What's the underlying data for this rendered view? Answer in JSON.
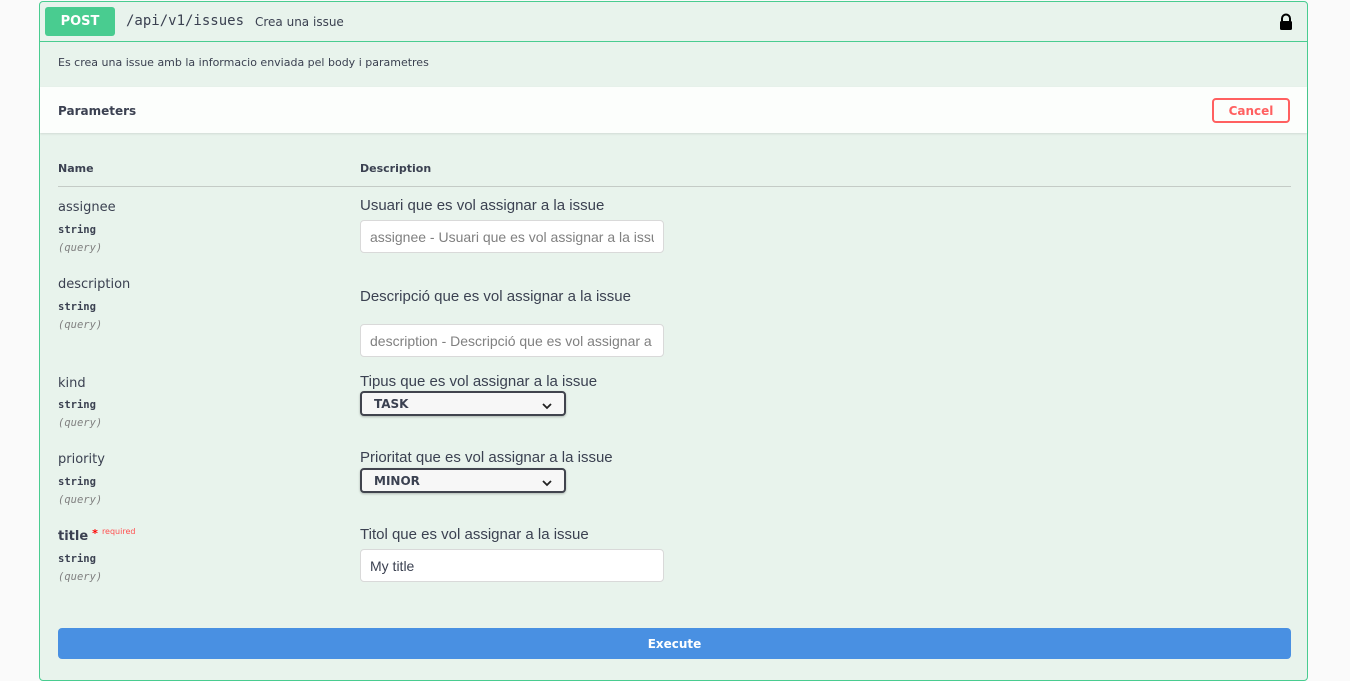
{
  "operation": {
    "method": "POST",
    "path": "/api/v1/issues",
    "summary": "Crea una issue",
    "description": "Es crea una issue amb la informacio enviada pel body i parametres"
  },
  "parameters_section": {
    "title": "Parameters",
    "cancel_label": "Cancel",
    "col_name": "Name",
    "col_description": "Description"
  },
  "params": [
    {
      "name": "assignee",
      "type": "string",
      "in": "(query)",
      "description": "Usuari que es vol assignar a la issue",
      "placeholder": "assignee - Usuari que es vol assignar a la issue",
      "value": ""
    },
    {
      "name": "description",
      "type": "string",
      "in": "(query)",
      "description": "Descripció que es vol assignar a la issue",
      "placeholder": "description - Descripció que es vol assignar a la issue",
      "value": ""
    },
    {
      "name": "kind",
      "type": "string",
      "in": "(query)",
      "description": "Tipus que es vol assignar a la issue",
      "selected": "TASK"
    },
    {
      "name": "priority",
      "type": "string",
      "in": "(query)",
      "description": "Prioritat que es vol assignar a la issue",
      "selected": "MINOR"
    },
    {
      "name": "title",
      "type": "string",
      "in": "(query)",
      "description": "Titol que es vol assignar a la issue",
      "required_mark": "*",
      "required_label": "required",
      "value": "My title"
    }
  ],
  "execute_label": "Execute",
  "colors": {
    "post": "#49cc90",
    "execute": "#4990e2",
    "cancel": "#ff6060"
  },
  "icons": {
    "lock": "lock-icon",
    "select": "chevron-down-icon"
  }
}
